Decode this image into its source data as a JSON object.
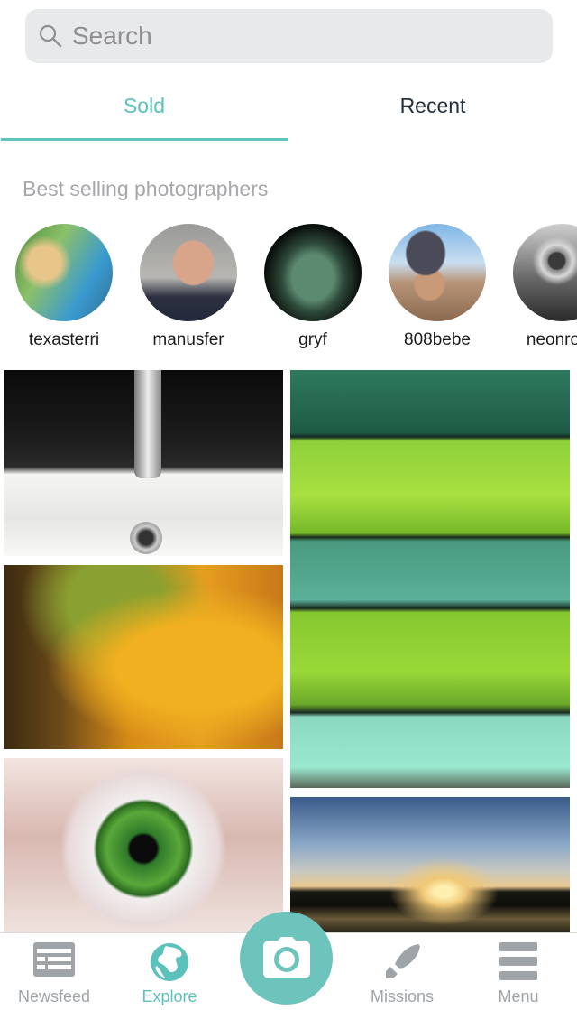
{
  "search": {
    "placeholder": "Search",
    "icon": "search-icon"
  },
  "tabs": [
    {
      "label": "Sold",
      "active": true
    },
    {
      "label": "Recent",
      "active": false
    }
  ],
  "section_title": "Best selling photographers",
  "photographers": [
    {
      "username": "texasterri"
    },
    {
      "username": "manusfer"
    },
    {
      "username": "gryf"
    },
    {
      "username": "808bebe"
    },
    {
      "username": "neonrock"
    }
  ],
  "feed": {
    "left_column": [
      {
        "subject": "bathroom sink faucet"
      },
      {
        "subject": "autumn tree foliage"
      },
      {
        "subject": "green eye close-up"
      }
    ],
    "right_column": [
      {
        "subject": "stacked green towels"
      },
      {
        "subject": "sunset over lake"
      }
    ]
  },
  "bottom_nav": {
    "items": [
      {
        "label": "Newsfeed",
        "icon": "newsfeed-icon",
        "active": false
      },
      {
        "label": "Explore",
        "icon": "globe-icon",
        "active": true
      },
      {
        "label": "Missions",
        "icon": "rocket-icon",
        "active": false
      },
      {
        "label": "Menu",
        "icon": "menu-icon",
        "active": false
      }
    ],
    "camera_icon": "camera-icon"
  },
  "colors": {
    "accent": "#5ac2bb",
    "inactive": "#9ea4a8",
    "search_bg": "#e8e9ea"
  }
}
